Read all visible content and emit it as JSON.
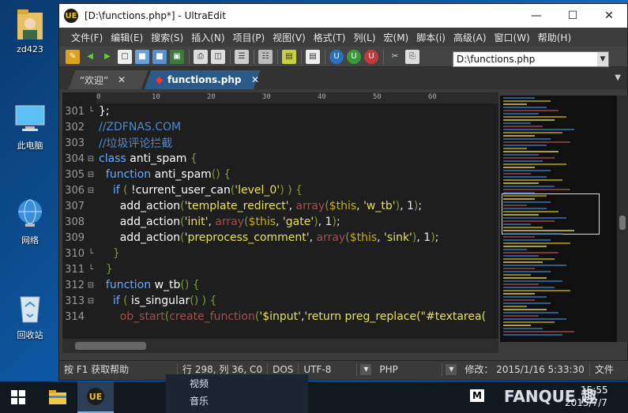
{
  "desktop": {
    "icons": [
      {
        "label": "zd423"
      },
      {
        "label": "此电脑"
      },
      {
        "label": "网络"
      },
      {
        "label": "回收站"
      }
    ]
  },
  "window": {
    "title": "[D:\\functions.php*] - UltraEdit",
    "menu": [
      "文件(F)",
      "编辑(E)",
      "搜索(S)",
      "插入(N)",
      "项目(P)",
      "视图(V)",
      "格式(T)",
      "列(L)",
      "宏(M)",
      "脚本(i)",
      "高级(A)",
      "窗口(W)",
      "帮助(H)"
    ],
    "path_value": "D:\\functions.php",
    "tabs": [
      {
        "label": "“欢迎”",
        "active": false
      },
      {
        "label": "functions.php",
        "active": true
      }
    ]
  },
  "ruler": [
    "0",
    "10",
    "20",
    "30",
    "40",
    "50",
    "60"
  ],
  "code": [
    {
      "num": "301",
      "fold": "└",
      "html": "<span class='c-fn'>};</span>"
    },
    {
      "num": "302",
      "fold": "",
      "html": "<span class='c-cm'>//ZDFNAS.COM</span>"
    },
    {
      "num": "303",
      "fold": "",
      "html": "<span class='c-cm'>//垃圾评论拦截</span>"
    },
    {
      "num": "304",
      "fold": "⊟",
      "html": "<span class='c-kw'>class</span> <span class='c-fn'>anti_spam</span> <span class='c-par'>{</span>"
    },
    {
      "num": "305",
      "fold": "⊟",
      "html": "&nbsp;&nbsp;<span class='c-kw'>function</span> <span class='c-fn'>anti_spam</span><span class='c-par'>()</span> <span class='c-par'>{</span>"
    },
    {
      "num": "306",
      "fold": "⊟",
      "html": "&nbsp;&nbsp;&nbsp;&nbsp;<span class='c-kw'>if</span> <span class='c-par'>(</span> !<span class='c-fn'>current_user_can</span><span class='c-par'>(</span><span class='c-str'>'level_0'</span><span class='c-par'>) ) {</span>"
    },
    {
      "num": "307",
      "fold": "",
      "html": "&nbsp;&nbsp;&nbsp;&nbsp;&nbsp;&nbsp;<span class='c-fn'>add_action</span><span class='c-par'>(</span><span class='c-str'>'template_redirect'</span>, <span class='c-arr'>array</span><span class='c-par'>(</span><span class='c-var'>$this</span>, <span class='c-str'>'w_tb'</span><span class='c-par'>)</span>, 1<span class='c-par'>)</span>;"
    },
    {
      "num": "308",
      "fold": "",
      "html": "&nbsp;&nbsp;&nbsp;&nbsp;&nbsp;&nbsp;<span class='c-fn'>add_action</span><span class='c-par'>(</span><span class='c-str'>'init'</span>, <span class='c-arr'>array</span><span class='c-par'>(</span><span class='c-var'>$this</span>, <span class='c-str'>'gate'</span><span class='c-par'>)</span>, 1<span class='c-par'>)</span>;"
    },
    {
      "num": "309",
      "fold": "",
      "html": "&nbsp;&nbsp;&nbsp;&nbsp;&nbsp;&nbsp;<span class='c-fn'>add_action</span><span class='c-par'>(</span><span class='c-str'>'preprocess_comment'</span>, <span class='c-arr'>array</span><span class='c-par'>(</span><span class='c-var'>$this</span>, <span class='c-str'>'sink'</span><span class='c-par'>)</span>, 1<span class='c-par'>)</span>;"
    },
    {
      "num": "310",
      "fold": "└",
      "html": "&nbsp;&nbsp;&nbsp;&nbsp;<span class='c-par'>}</span>"
    },
    {
      "num": "311",
      "fold": "└",
      "html": "&nbsp;&nbsp;<span class='c-par'>}</span>"
    },
    {
      "num": "312",
      "fold": "⊟",
      "html": "&nbsp;&nbsp;<span class='c-kw'>function</span> <span class='c-fn'>w_tb</span><span class='c-par'>() {</span>"
    },
    {
      "num": "313",
      "fold": "⊟",
      "html": "&nbsp;&nbsp;&nbsp;&nbsp;<span class='c-kw'>if</span> <span class='c-par'>(</span> <span class='c-fn'>is_singular</span><span class='c-par'>() ) {</span>"
    },
    {
      "num": "314",
      "fold": "",
      "html": "&nbsp;&nbsp;&nbsp;&nbsp;&nbsp;&nbsp;<span class='c-arr'>ob_start</span><span class='c-par'>(</span><span class='c-arr'>create_function</span><span class='c-par'>(</span><span class='c-str'>'$input'</span>,<span class='c-str'>'return preg_replace(\"#textarea(</span>"
    }
  ],
  "status": {
    "help": "按 F1 获取帮助",
    "position": "行 298, 列 36, C0",
    "lineend": "DOS",
    "encoding": "UTF-8",
    "syntax": "PHP",
    "modified": "修改： 2015/1/16 5:33:30",
    "file": "文件"
  },
  "taskbar": {
    "startmenu_items": [
      "视频",
      "音乐"
    ],
    "ime": "M",
    "clock": "15:55",
    "date": "2015/7/7",
    "watermark": "FANQUE 趣"
  },
  "colors": {
    "window_bg": "#3b3b3b",
    "active_tab": "#2a5a8a",
    "desktop": "#0d5aa7",
    "taskbar": "#101820"
  }
}
